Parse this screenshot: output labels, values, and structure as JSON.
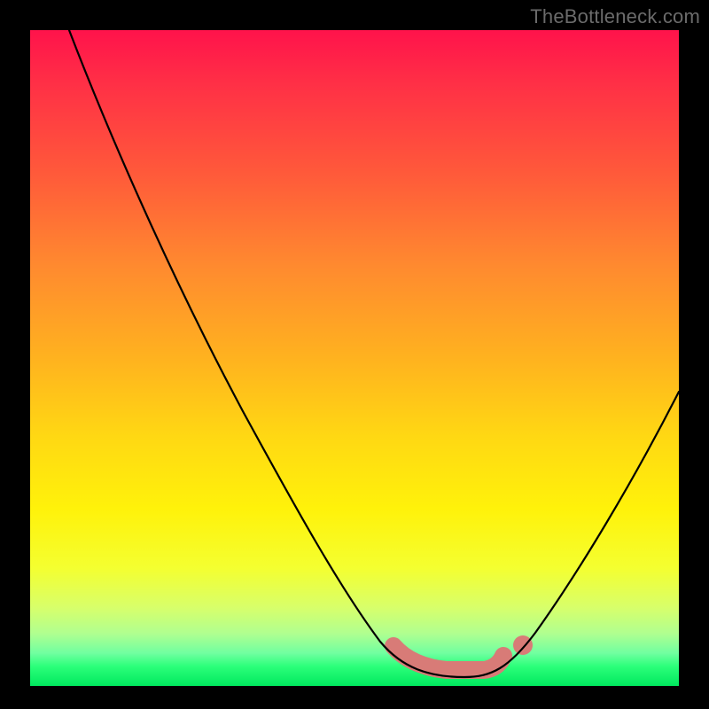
{
  "attribution": "TheBottleneck.com",
  "chart_data": {
    "type": "line",
    "title": "",
    "xlabel": "",
    "ylabel": "",
    "xlim": [
      0,
      100
    ],
    "ylim": [
      0,
      100
    ],
    "series": [
      {
        "name": "bottleneck-curve",
        "x": [
          6,
          10,
          15,
          20,
          25,
          30,
          35,
          40,
          45,
          50,
          53,
          56,
          60,
          65,
          70,
          73,
          78,
          84,
          90,
          96,
          100
        ],
        "y": [
          100,
          92,
          83,
          74,
          64,
          55,
          45,
          36,
          26,
          16,
          10,
          6,
          3,
          2,
          2,
          3,
          8,
          16,
          26,
          37,
          45
        ]
      }
    ],
    "highlight": {
      "name": "optimal-valley",
      "x": [
        56,
        60,
        65,
        70,
        73
      ],
      "y": [
        6,
        3,
        2,
        2,
        3
      ]
    },
    "gradient_scale": {
      "top_color": "#ff134b",
      "bottom_color": "#00e85e",
      "meaning_top": "high-bottleneck",
      "meaning_bottom": "no-bottleneck"
    }
  }
}
